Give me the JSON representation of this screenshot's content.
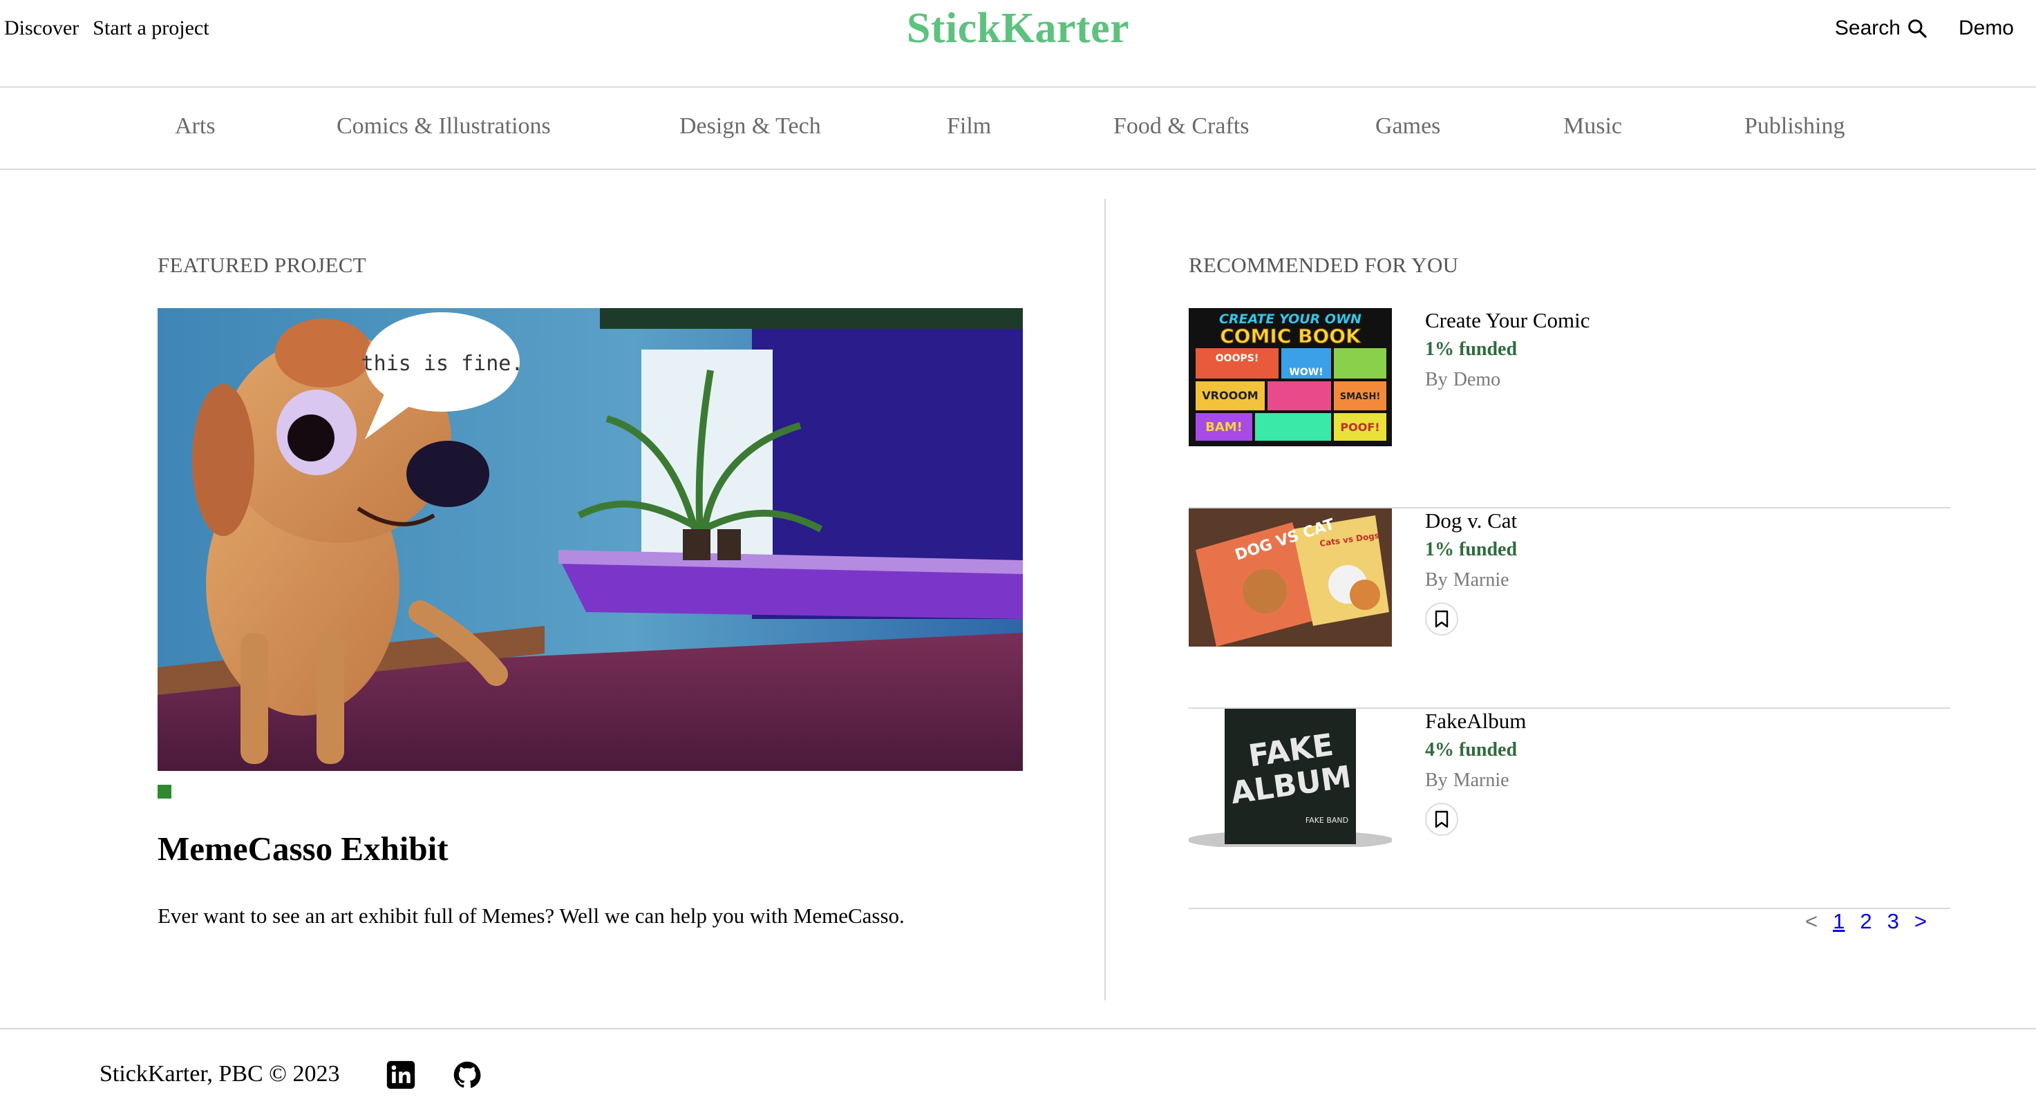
{
  "header": {
    "nav_left": [
      "Discover",
      "Start a project"
    ],
    "logo": "StickKarter",
    "search_label": "Search",
    "user_label": "Demo"
  },
  "categories": [
    "Arts",
    "Comics & Illustrations",
    "Design & Tech",
    "Film",
    "Food & Crafts",
    "Games",
    "Music",
    "Publishing"
  ],
  "featured": {
    "section_label": "FEATURED PROJECT",
    "bubble_text": "this is fine.",
    "title": "MemeCasso Exhibit",
    "description": "Ever want to see an art exhibit full of Memes? Well we can help you with MemeCasso.",
    "accent_color": "#2e8a2e"
  },
  "recommended": {
    "section_label": "RECOMMENDED FOR YOU",
    "items": [
      {
        "title": "Create Your Comic",
        "funded": "1% funded",
        "by_prefix": "By",
        "author": "Demo",
        "thumb_text": [
          "CREATE YOUR OWN",
          "COMIC BOOK",
          "OOOPS!",
          "WOW!",
          "VROOOM",
          "SMASH!",
          "BAM!",
          "POOF!"
        ],
        "bookmark": false
      },
      {
        "title": "Dog v. Cat",
        "funded": "1% funded",
        "by_prefix": "By",
        "author": "Marnie",
        "thumb_text": [
          "DOG VS CAT",
          "Cats vs Dogs"
        ],
        "bookmark": true
      },
      {
        "title": "FakeAlbum",
        "funded": "4% funded",
        "by_prefix": "By",
        "author": "Marnie",
        "thumb_text": [
          "FAKE",
          "ALBUM",
          "FAKE BAND"
        ],
        "bookmark": true
      }
    ]
  },
  "pagination": {
    "prev": "<",
    "pages": [
      "1",
      "2",
      "3"
    ],
    "current": "1",
    "next": ">"
  },
  "footer": {
    "copyright": "StickKarter, PBC © 2023",
    "icons": [
      "linkedin-icon",
      "github-icon"
    ]
  },
  "colors": {
    "brand": "#5cc27e",
    "funded": "#2f6b3c",
    "link": "#0000ee"
  }
}
